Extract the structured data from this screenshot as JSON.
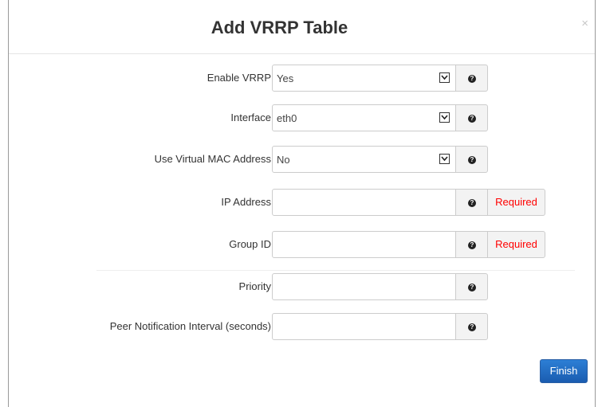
{
  "modal": {
    "title": "Add VRRP Table",
    "close_label": "×"
  },
  "form": {
    "enable_vrrp": {
      "label": "Enable VRRP",
      "value": "Yes"
    },
    "interface": {
      "label": "Interface",
      "value": "eth0"
    },
    "use_virtual_mac": {
      "label": "Use Virtual MAC Address",
      "value": "No"
    },
    "ip_address": {
      "label": "IP Address",
      "value": "",
      "badge": "Required"
    },
    "group_id": {
      "label": "Group ID",
      "value": "",
      "badge": "Required"
    },
    "priority": {
      "label": "Priority",
      "value": ""
    },
    "peer_notification_interval": {
      "label": "Peer Notification Interval (seconds)",
      "value": ""
    }
  },
  "help_icon_glyph": "?",
  "footer": {
    "finish_label": "Finish"
  },
  "colors": {
    "required_text": "#ff0000",
    "finish_button": "#1a5cb0"
  },
  "icons": {
    "help": "question-circle-icon",
    "dropdown": "chevron-down-icon",
    "close": "close-icon"
  }
}
